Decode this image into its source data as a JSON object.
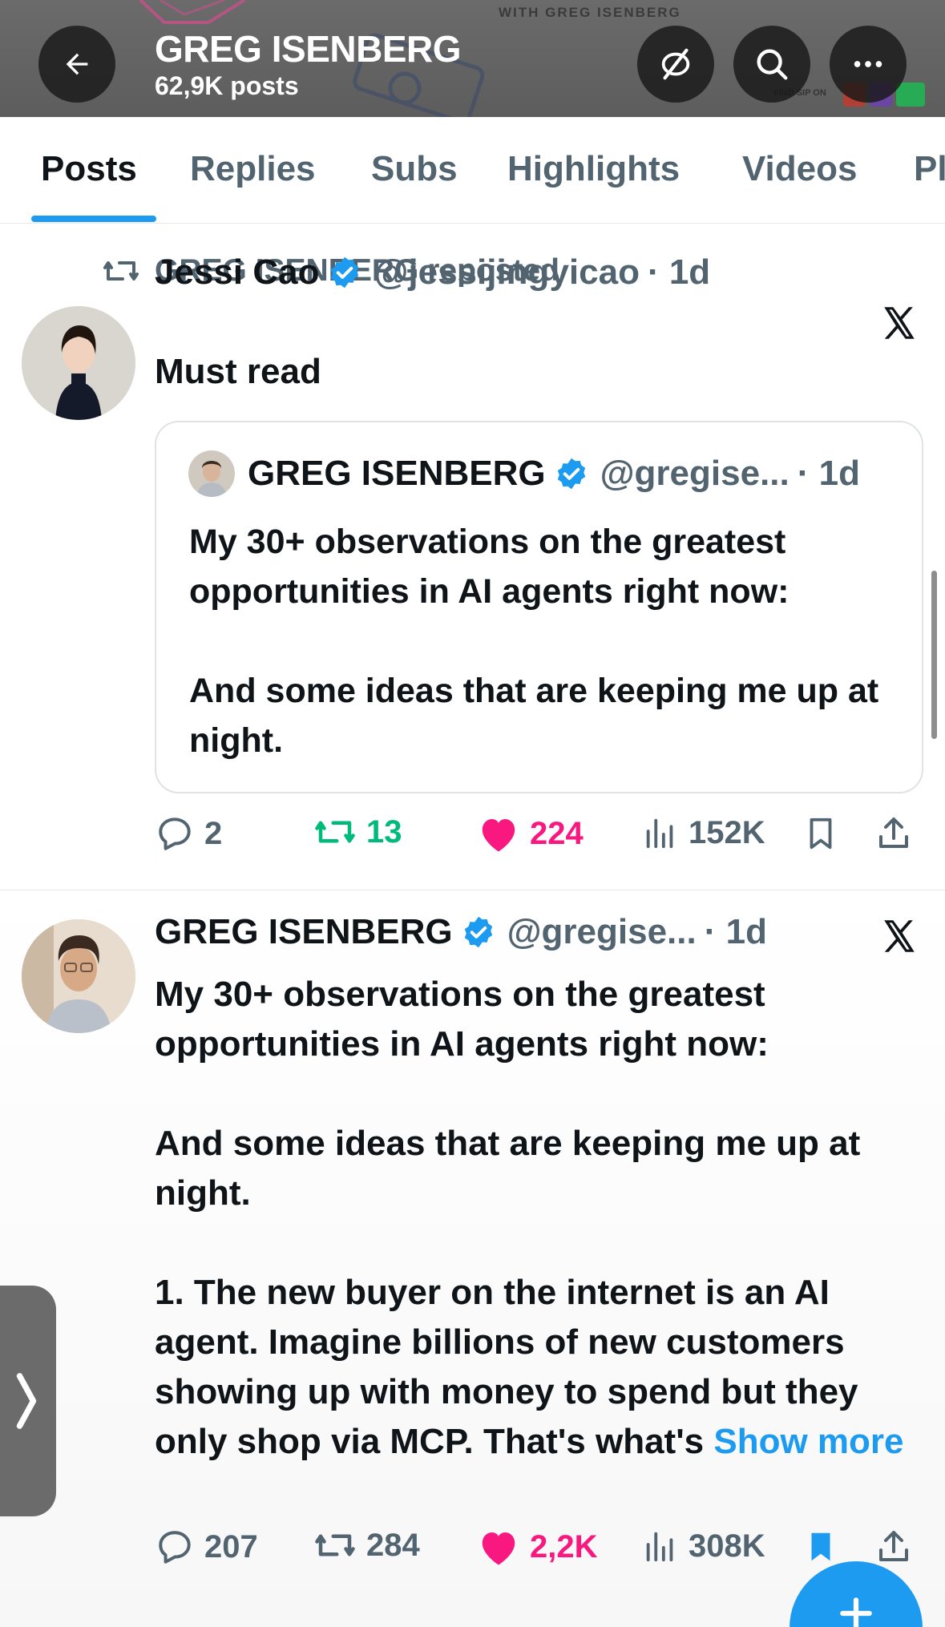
{
  "header": {
    "title": "GREG ISENBERG",
    "posts_count": "62,9K posts",
    "banner_text": "WITH GREG ISENBERG",
    "banner_find": "FIND SIP ON"
  },
  "tabs": [
    {
      "label": "Posts",
      "active": true
    },
    {
      "label": "Replies",
      "active": false
    },
    {
      "label": "Subs",
      "active": false
    },
    {
      "label": "Highlights",
      "active": false
    },
    {
      "label": "Videos",
      "active": false
    },
    {
      "label": "Pl",
      "active": false
    }
  ],
  "posts": [
    {
      "repost_label": "GREG ISENBERG reposted",
      "author": "Jessi Cao",
      "handle": "@jessijingyicao",
      "time": "· 1d",
      "text": "Must read",
      "quote": {
        "author": "GREG ISENBERG",
        "handle": "@gregise...",
        "time": "· 1d",
        "text": "My 30+ observations on the greatest opportunities in AI agents right now:\n\nAnd some ideas that are keeping me up at night."
      },
      "stats": {
        "replies": "2",
        "reposts": "13",
        "likes": "224",
        "views": "152K"
      }
    },
    {
      "author": "GREG ISENBERG",
      "handle": "@gregise...",
      "time": "· 1d",
      "text": "My 30+ observations on the greatest opportunities in AI agents right now:\n\nAnd some ideas that are keeping me up at night.\n\n1. The new buyer on the internet is an AI agent. Imagine billions of new customers showing up with money to spend but they only shop via MCP. That's what's ",
      "show_more": "Show more",
      "stats": {
        "replies": "207",
        "reposts": "284",
        "likes": "2,2K",
        "views": "308K"
      }
    }
  ],
  "colors": {
    "accent": "#1d9bf0",
    "repost_green": "#00ba7c",
    "like_pink": "#f91880",
    "secondary_text": "#536471"
  },
  "icons": [
    "back-arrow-icon",
    "link-off-icon",
    "search-icon",
    "more-icon",
    "repost-icon",
    "verified-icon",
    "x-logo-icon",
    "reply-icon",
    "like-icon",
    "views-icon",
    "bookmark-icon",
    "share-icon",
    "chevron-right-icon",
    "compose-plus-icon"
  ]
}
